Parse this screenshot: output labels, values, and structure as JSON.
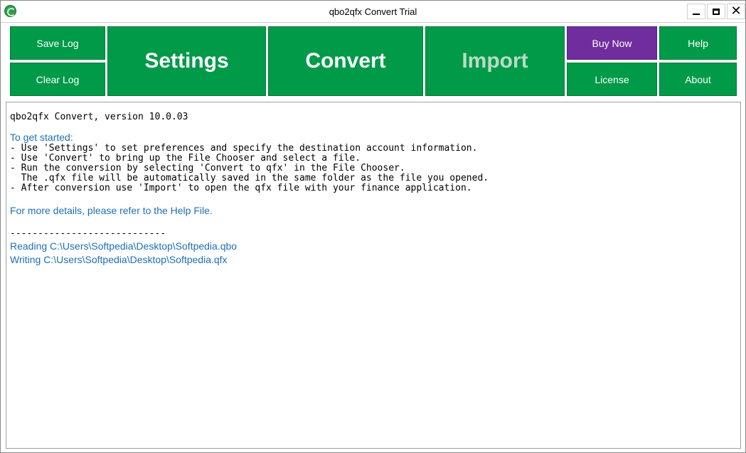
{
  "window": {
    "title": "qbo2qfx Convert Trial"
  },
  "toolbar": {
    "save_log": "Save Log",
    "clear_log": "Clear Log",
    "settings": "Settings",
    "convert": "Convert",
    "import": "Import",
    "buy_now": "Buy Now",
    "license": "License",
    "help": "Help",
    "about": "About"
  },
  "log": {
    "version_line": "qbo2qfx Convert, version 10.0.03",
    "get_started": "To get started:",
    "instructions": [
      "- Use 'Settings' to set preferences and specify the destination account information.",
      "- Use 'Convert' to bring up the File Chooser and select a file.",
      "- Run the conversion by selecting 'Convert to qfx' in the File Chooser.",
      "  The .qfx file will be automatically saved in the same folder as the file you opened.",
      "- After conversion use 'Import' to open the qfx file with your finance application."
    ],
    "more_details": "For more details, please refer to the Help File.",
    "separator": "----------------------------",
    "reading": "Reading C:\\Users\\Softpedia\\Desktop\\Softpedia.qbo",
    "writing": "Writing C:\\Users\\Softpedia\\Desktop\\Softpedia.qfx"
  },
  "colors": {
    "button_green": "#009a49",
    "buy_now_purple": "#6f2d9e",
    "log_link_blue": "#1f6fb5"
  },
  "icons": [
    "app-logo-icon",
    "minimize-icon",
    "maximize-icon",
    "close-icon"
  ]
}
